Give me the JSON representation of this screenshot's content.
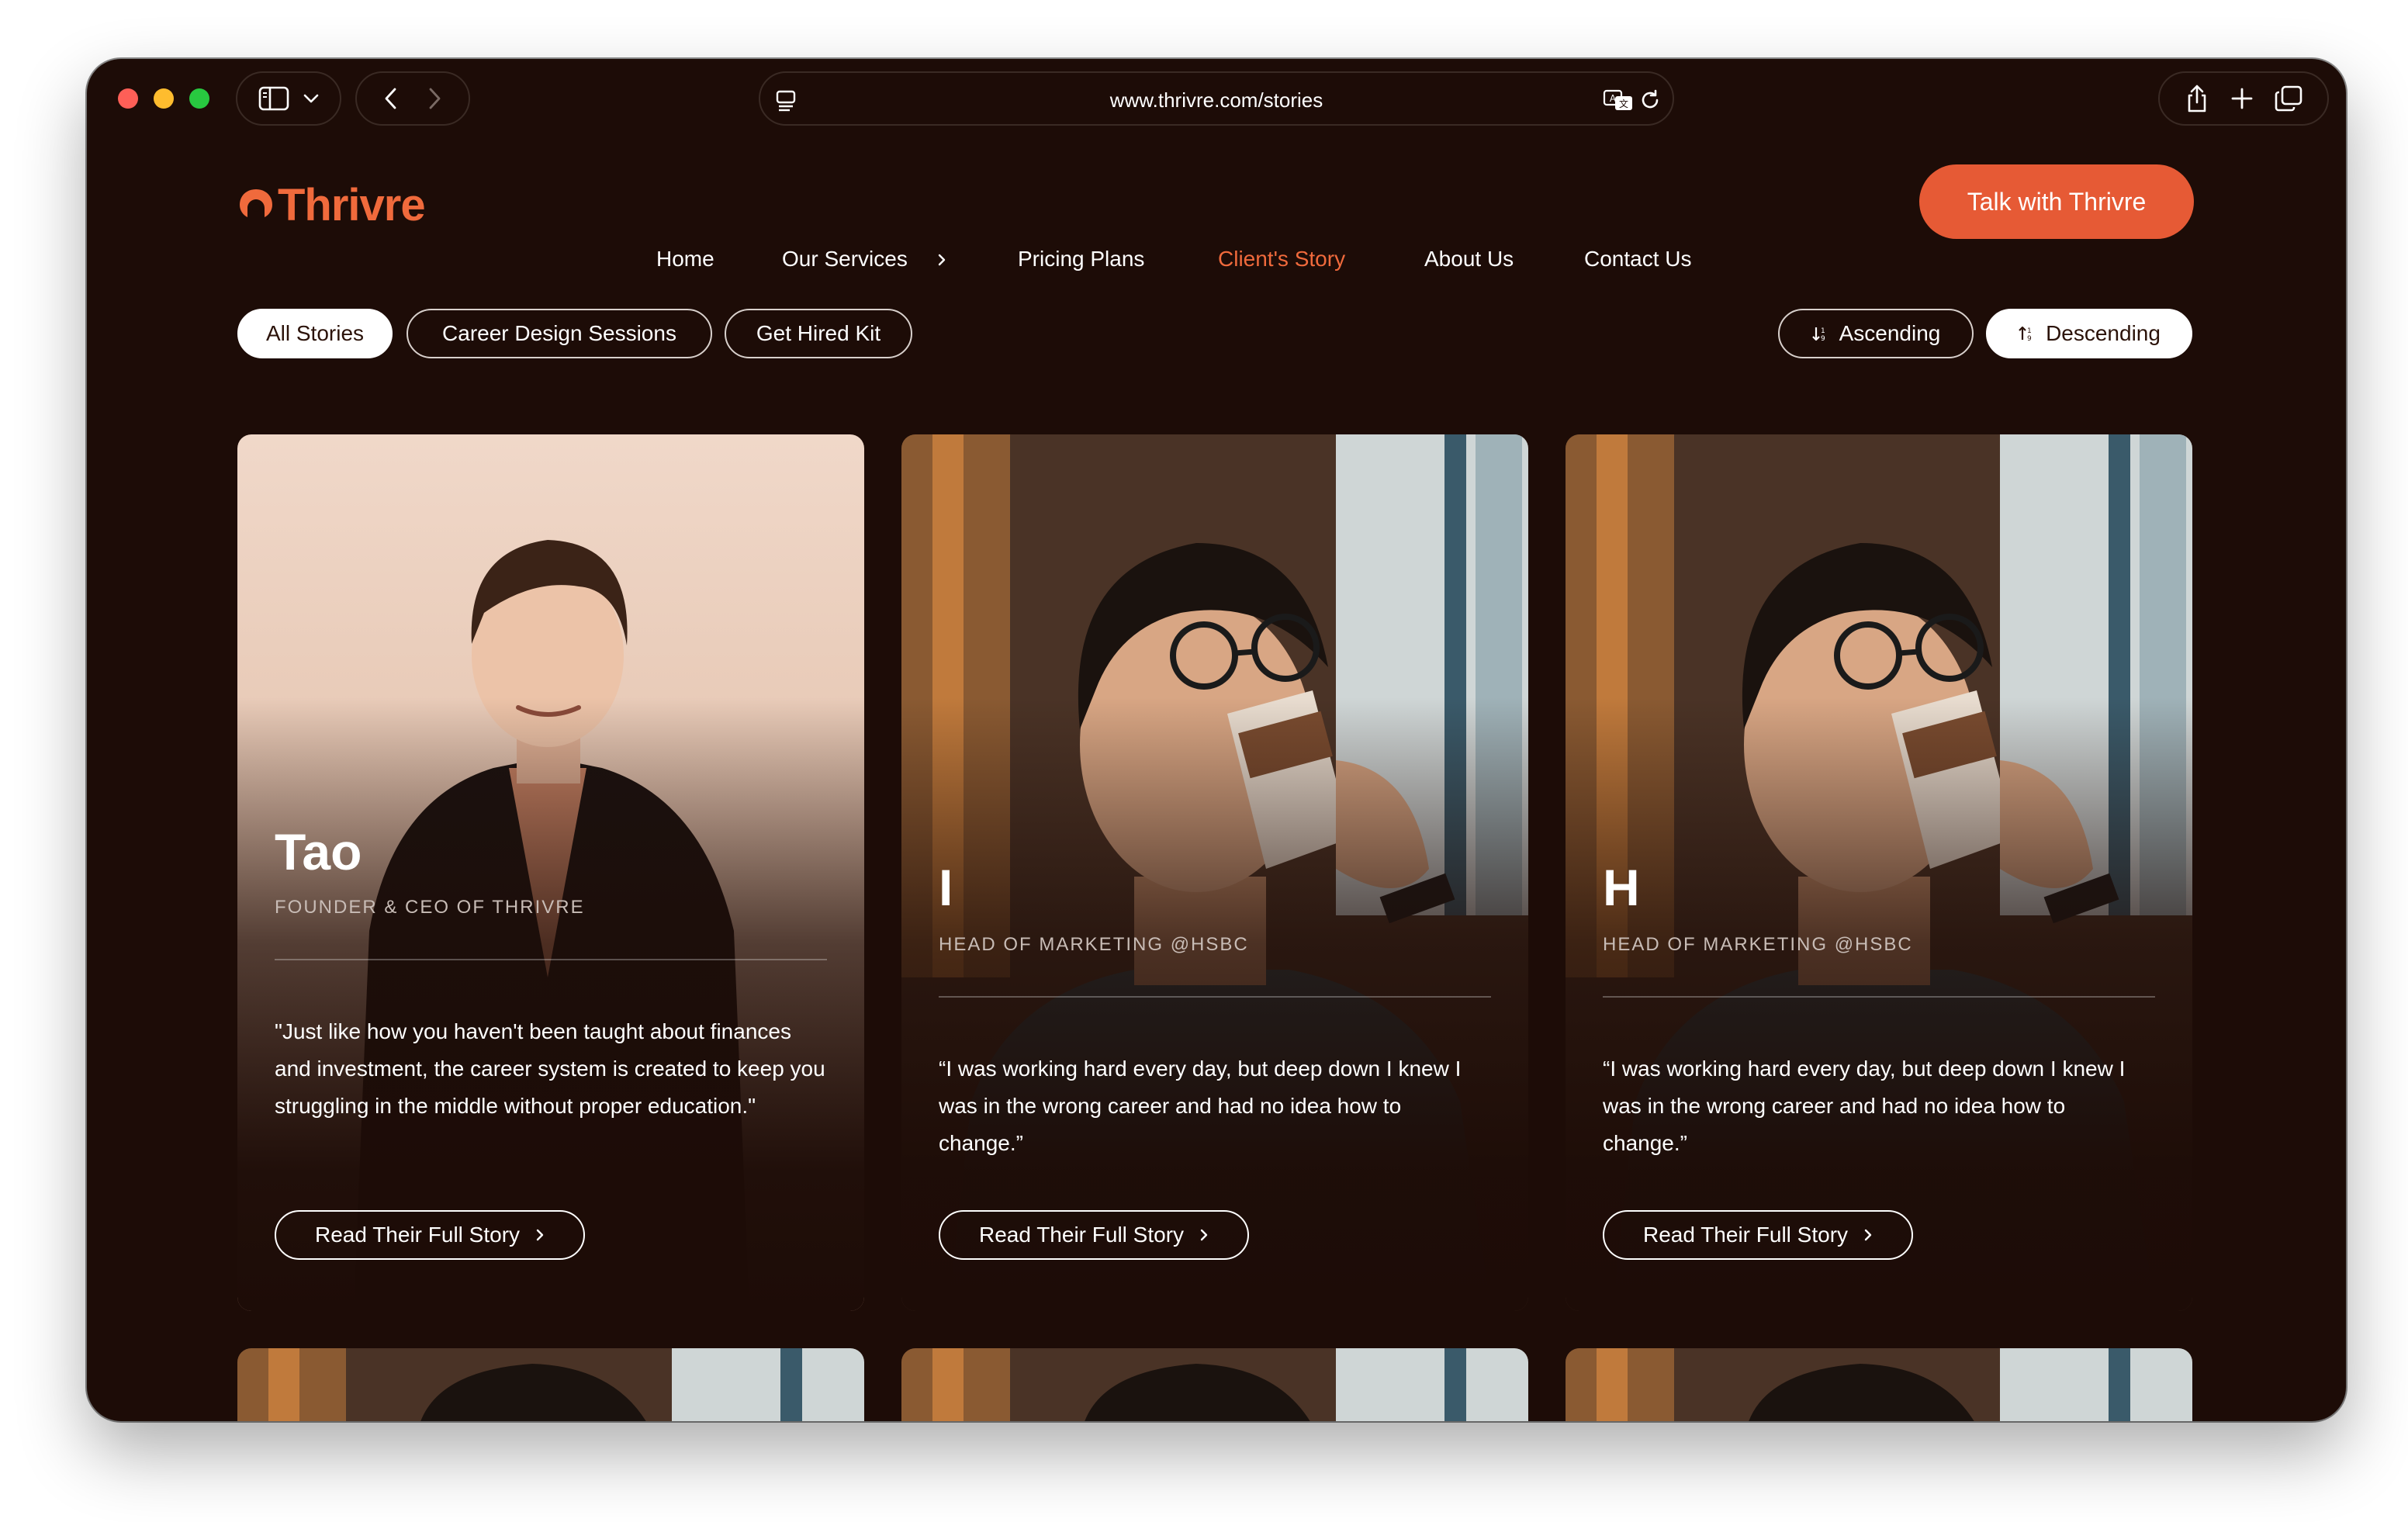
{
  "browser": {
    "url": "www.thrivre.com/stories",
    "icons": [
      "sidebar-icon",
      "chevron-down-icon",
      "back-icon",
      "forward-icon",
      "page-menu-icon",
      "translate-icon",
      "reload-icon",
      "share-icon",
      "new-tab-icon",
      "tab-overview-icon"
    ]
  },
  "site": {
    "logo": "Thrivre",
    "nav": [
      {
        "label": "Home"
      },
      {
        "label": "Our Services"
      },
      {
        "label": "Pricing Plans"
      },
      {
        "label": "Client's Story"
      },
      {
        "label": "About Us"
      },
      {
        "label": "Contact Us"
      }
    ],
    "active_nav": "Client's Story",
    "cta": "Talk with Thrivre",
    "accent_color": "#e65a35",
    "background_color": "#1d0c07"
  },
  "filters": {
    "categories": [
      "All Stories",
      "Career Design Sessions",
      "Get Hired Kit"
    ],
    "selected_category": "All Stories",
    "sort": [
      "Ascending",
      "Descending"
    ],
    "selected_sort": "Descending"
  },
  "stories": [
    {
      "name": "Tao",
      "role": "FOUNDER & CEO OF THRIVRE",
      "quote": "\"Just like how you haven't been taught about finances and investment, the career system is created to keep you struggling in the middle without proper education.\"",
      "button": "Read Their Full Story"
    },
    {
      "name": "I",
      "role": "HEAD OF MARKETING @HSBC",
      "quote": "“I was working hard every day, but deep down I knew I was in the wrong career and had no idea how to change.”",
      "button": "Read Their Full Story"
    },
    {
      "name": "H",
      "role": "HEAD OF MARKETING @HSBC",
      "quote": "“I was working hard every day, but deep down I knew I was in the wrong career and had no idea how to change.”",
      "button": "Read Their Full Story"
    }
  ]
}
